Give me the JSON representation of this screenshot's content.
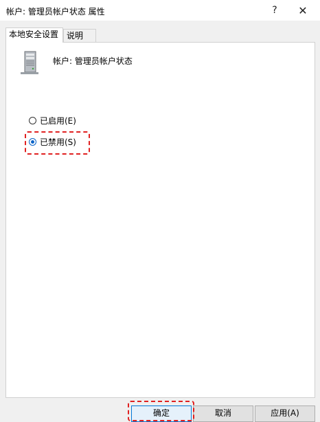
{
  "window": {
    "title": "帐户: 管理员帐户状态 属性",
    "help_label": "?",
    "close_label": "✕"
  },
  "tabs": [
    {
      "label": "本地安全设置",
      "active": true
    },
    {
      "label": "说明",
      "active": false
    }
  ],
  "policy": {
    "name": "帐户: 管理员帐户状态",
    "icon": "server-icon"
  },
  "options": [
    {
      "label": "已启用(E)",
      "selected": false
    },
    {
      "label": "已禁用(S)",
      "selected": true
    }
  ],
  "buttons": {
    "ok_label": "确定",
    "cancel_label": "取消",
    "apply_label": "应用(A)"
  },
  "colors": {
    "highlight": "#e02020",
    "accent": "#0a64c8"
  }
}
